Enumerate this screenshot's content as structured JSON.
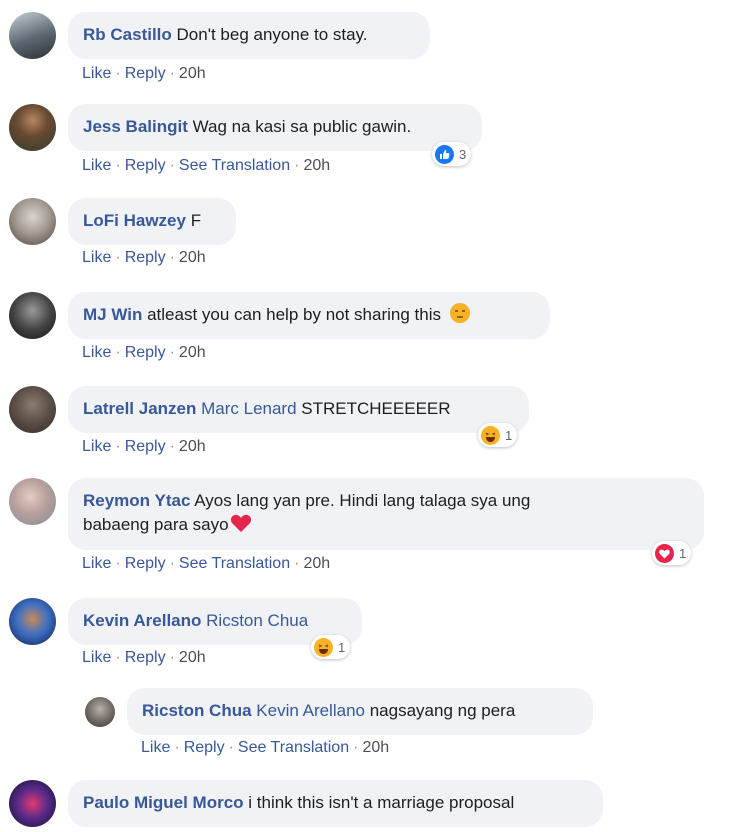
{
  "actions": {
    "like": "Like",
    "reply": "Reply",
    "see_translation": "See Translation",
    "sep": "·"
  },
  "comments": [
    {
      "author": "Rb Castillo",
      "text": "Don't beg anyone to stay.",
      "time": "20h"
    },
    {
      "author": "Jess Balingit",
      "text": "Wag na kasi sa public gawin.",
      "time": "20h",
      "reaction_count": "3",
      "reaction_icon": "like-icon"
    },
    {
      "author": "LoFi Hawzey",
      "text": "F",
      "time": "20h"
    },
    {
      "author": "MJ Win",
      "text": "atleast you can help by not sharing this",
      "time": "20h",
      "inline_emoji": "unamused-face-emoji"
    },
    {
      "author": "Latrell Janzen",
      "mention": "Marc Lenard",
      "text": "STRETCHEEEEER",
      "time": "20h",
      "reaction_count": "1",
      "reaction_icon": "haha-icon"
    },
    {
      "author": "Reymon Ytac",
      "text": "Ayos lang yan pre. Hindi lang talaga sya ung",
      "text2": "babaeng para sayo",
      "time": "20h",
      "inline_emoji": "red-heart-emoji",
      "reaction_count": "1",
      "reaction_icon": "love-icon"
    },
    {
      "author": "Kevin Arellano",
      "mention": "Ricston Chua",
      "time": "20h",
      "reaction_count": "1",
      "reaction_icon": "haha-icon"
    },
    {
      "author": "Ricston Chua",
      "mention": "Kevin Arellano",
      "text": "nagsayang ng pera",
      "time": "20h"
    },
    {
      "author": "Paulo Miguel Morco",
      "text": "i think this isn't a marriage proposal"
    }
  ],
  "colors": {
    "link": "#385898",
    "bubble": "#f0f2f5",
    "like": "#1877f2",
    "haha": "#f7b125",
    "love": "#e4264c"
  }
}
